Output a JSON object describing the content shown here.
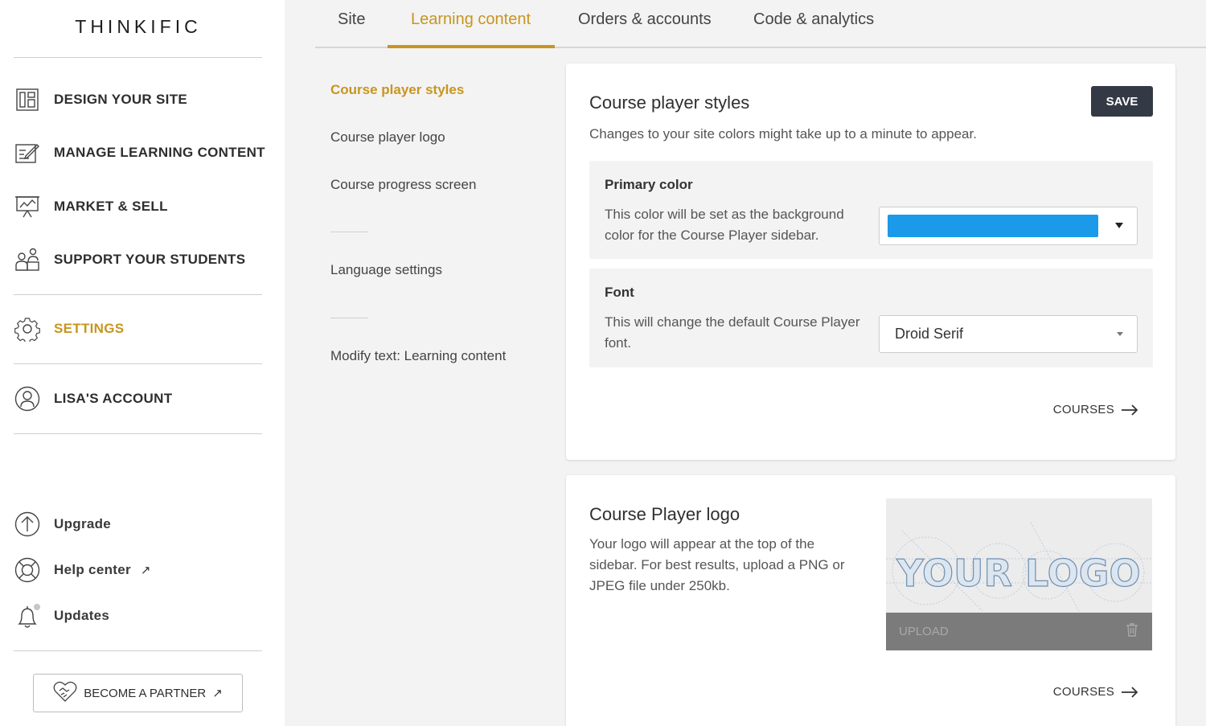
{
  "app": {
    "logo": "THINKIFIC"
  },
  "sidebar": {
    "items": [
      {
        "label": "DESIGN YOUR SITE",
        "icon": "layout-icon"
      },
      {
        "label": "MANAGE LEARNING CONTENT",
        "icon": "edit-content-icon"
      },
      {
        "label": "MARKET & SELL",
        "icon": "presentation-chart-icon"
      },
      {
        "label": "SUPPORT YOUR STUDENTS",
        "icon": "students-icon"
      },
      {
        "label": "SETTINGS",
        "icon": "gear-icon"
      },
      {
        "label": "LISA'S ACCOUNT",
        "icon": "user-icon"
      }
    ],
    "bottom": [
      {
        "label": "Upgrade",
        "icon": "upgrade-icon"
      },
      {
        "label": "Help center",
        "icon": "lifebuoy-icon",
        "ext": "↗"
      },
      {
        "label": "Updates",
        "icon": "bell-icon"
      }
    ],
    "partner_label": "BECOME A PARTNER",
    "partner_ext": "↗"
  },
  "tabs": [
    "Site",
    "Learning content",
    "Orders & accounts",
    "Code & analytics"
  ],
  "subnav": {
    "items": [
      "Course player styles",
      "Course player logo",
      "Course progress screen",
      "Language settings",
      "Modify text: Learning content"
    ]
  },
  "styles_card": {
    "title": "Course player styles",
    "subtitle": "Changes to your site colors might take up to a minute to appear.",
    "save_label": "SAVE",
    "primary": {
      "title": "Primary color",
      "desc": "This color will be set as the background color for the Course Player sidebar.",
      "color": "#1a9ae8"
    },
    "font": {
      "title": "Font",
      "desc": "This will change the default Course Player font.",
      "value": "Droid Serif"
    },
    "courses_label": "COURSES"
  },
  "logo_card": {
    "title": "Course Player logo",
    "desc": "Your logo will appear at the top of the sidebar. For best results, upload a PNG or JPEG file under 250kb.",
    "placeholder_text": "YOUR LOGO",
    "upload_label": "UPLOAD",
    "courses_label": "COURSES"
  },
  "colors": {
    "accent": "#c8951f",
    "dark_button": "#343a45"
  }
}
